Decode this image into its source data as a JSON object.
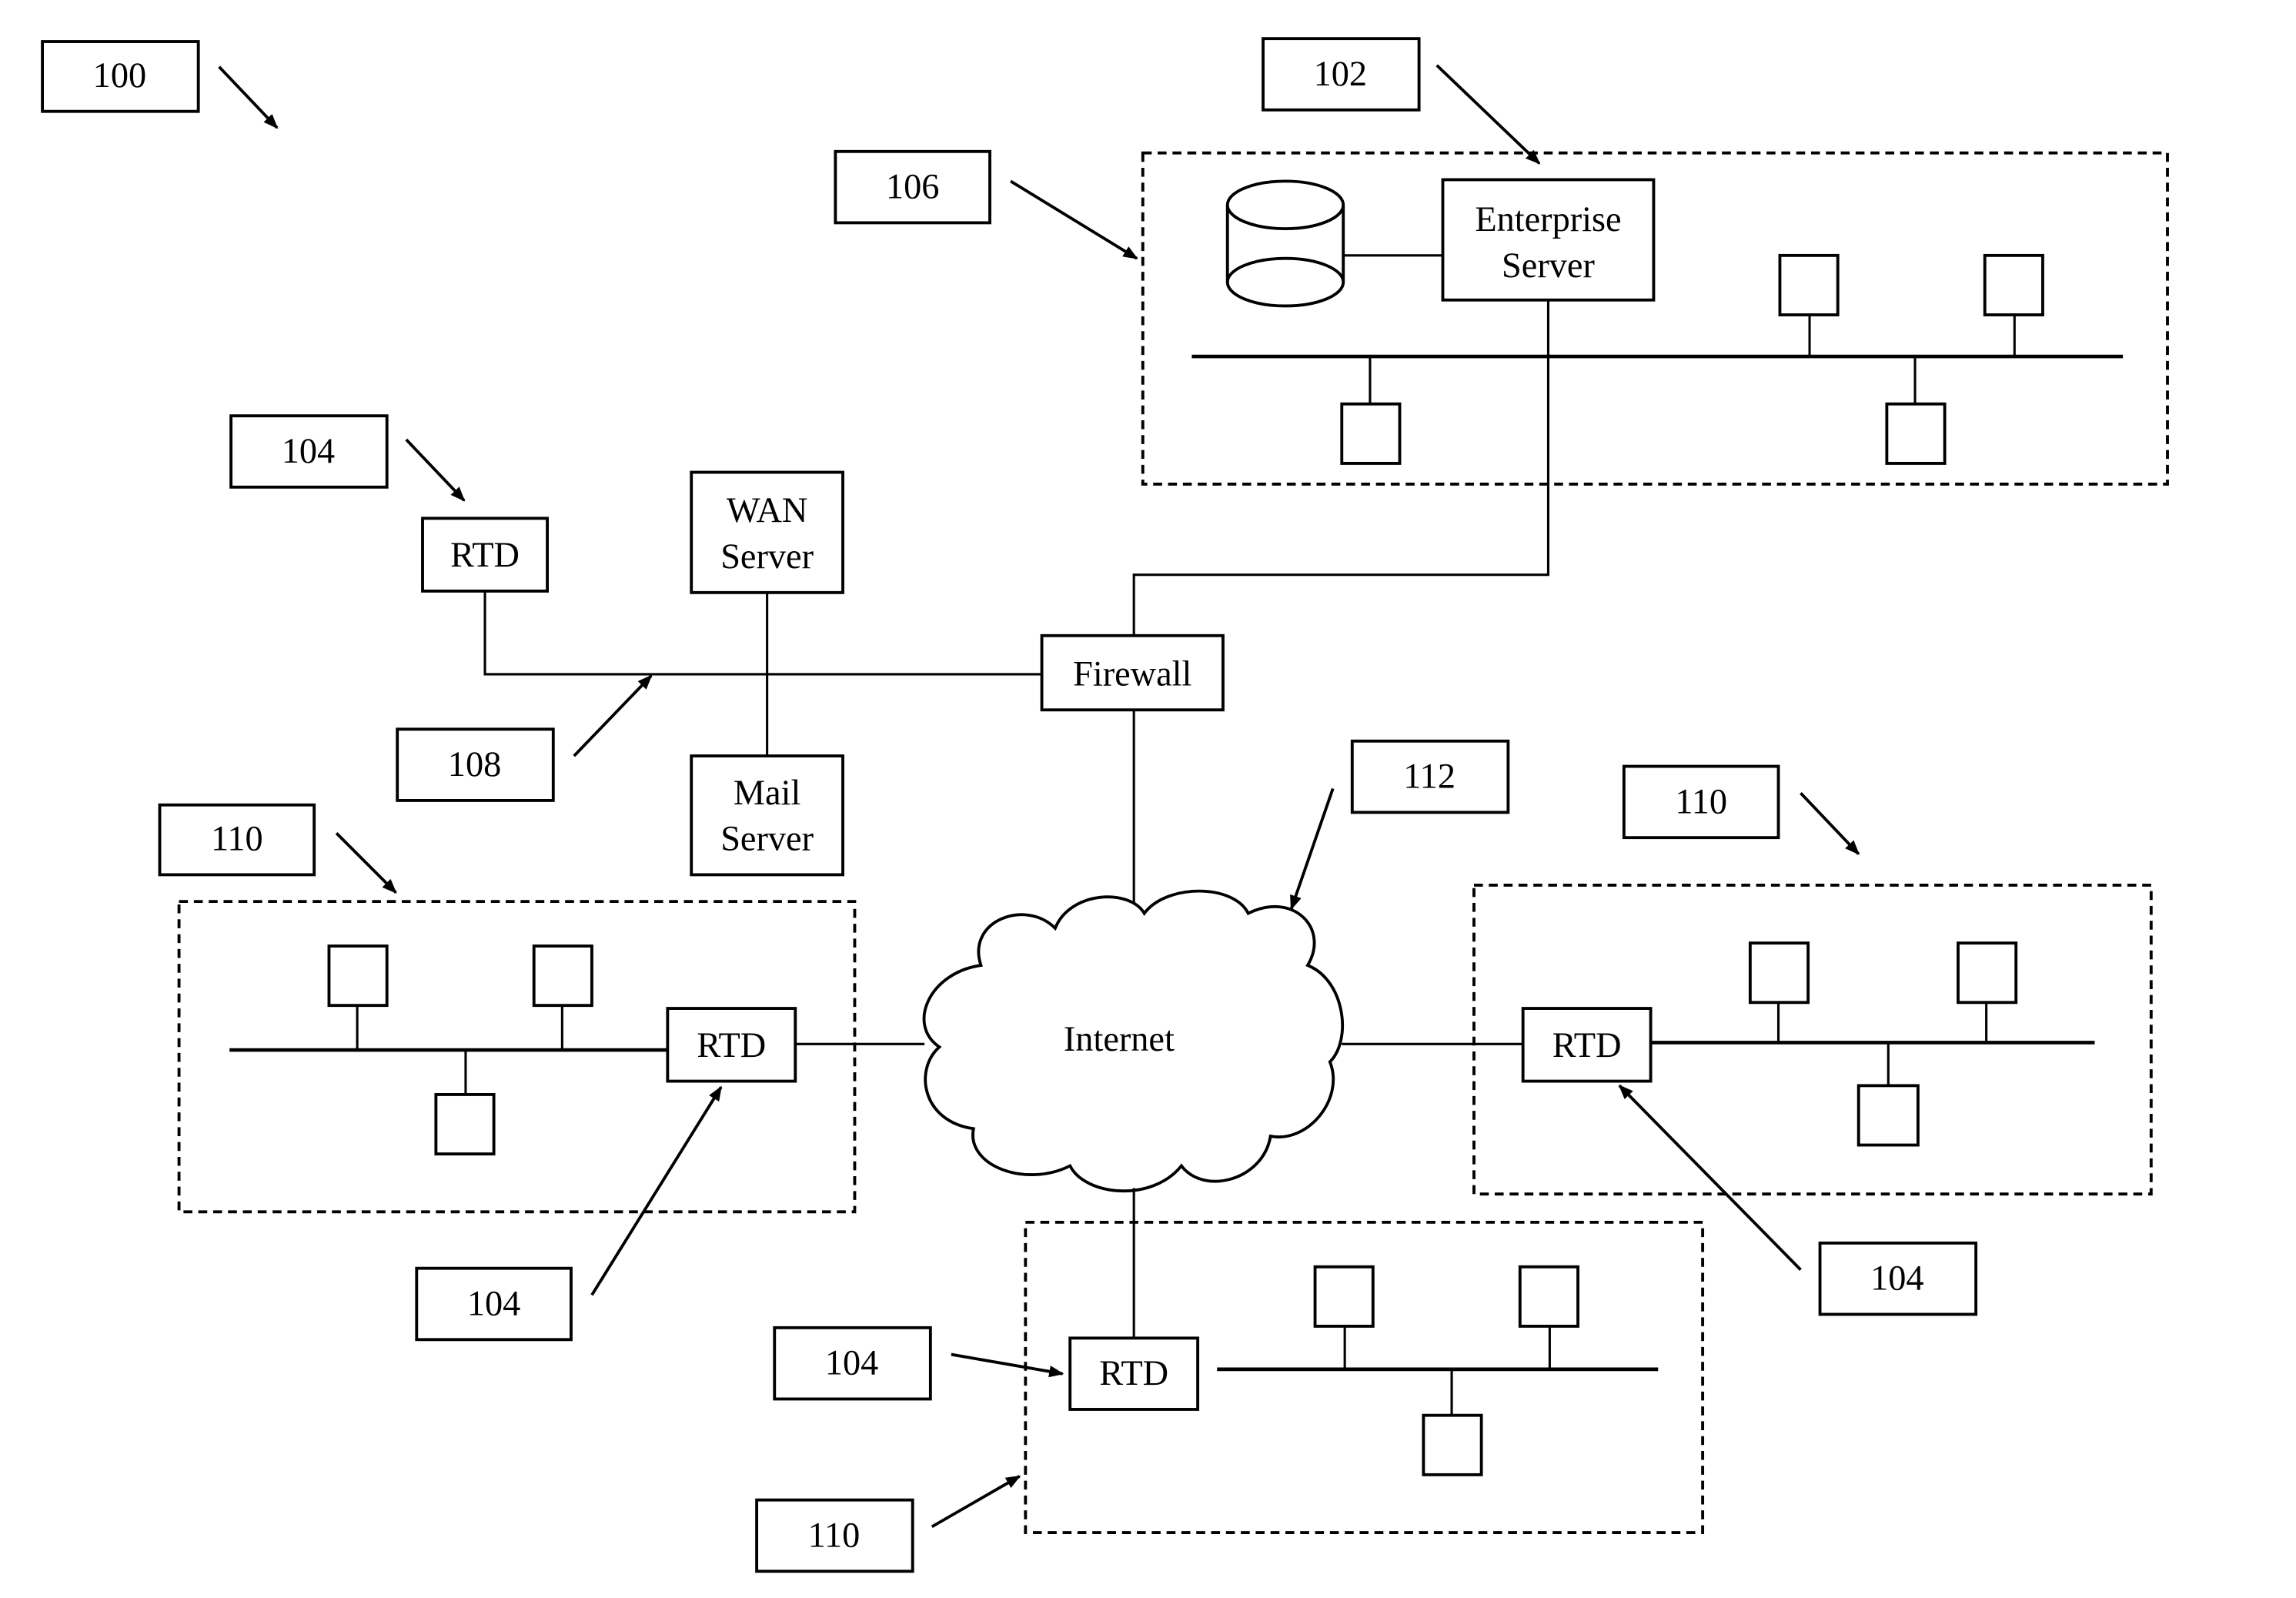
{
  "figure": {
    "reference_labels": {
      "system": "100",
      "enterprise_server_ref": "102",
      "rtd_ref": "104",
      "enterprise_network_ref": "106",
      "wan_ref": "108",
      "remote_site_ref": "110",
      "internet_ref": "112"
    },
    "nodes": {
      "enterprise_server": [
        "Enterprise",
        "Server"
      ],
      "wan_server": [
        "WAN",
        "Server"
      ],
      "mail_server": [
        "Mail",
        "Server"
      ],
      "firewall": "Firewall",
      "internet": "Internet",
      "rtd": "RTD"
    },
    "colors": {
      "ink": "#000000",
      "background": "#ffffff"
    }
  }
}
